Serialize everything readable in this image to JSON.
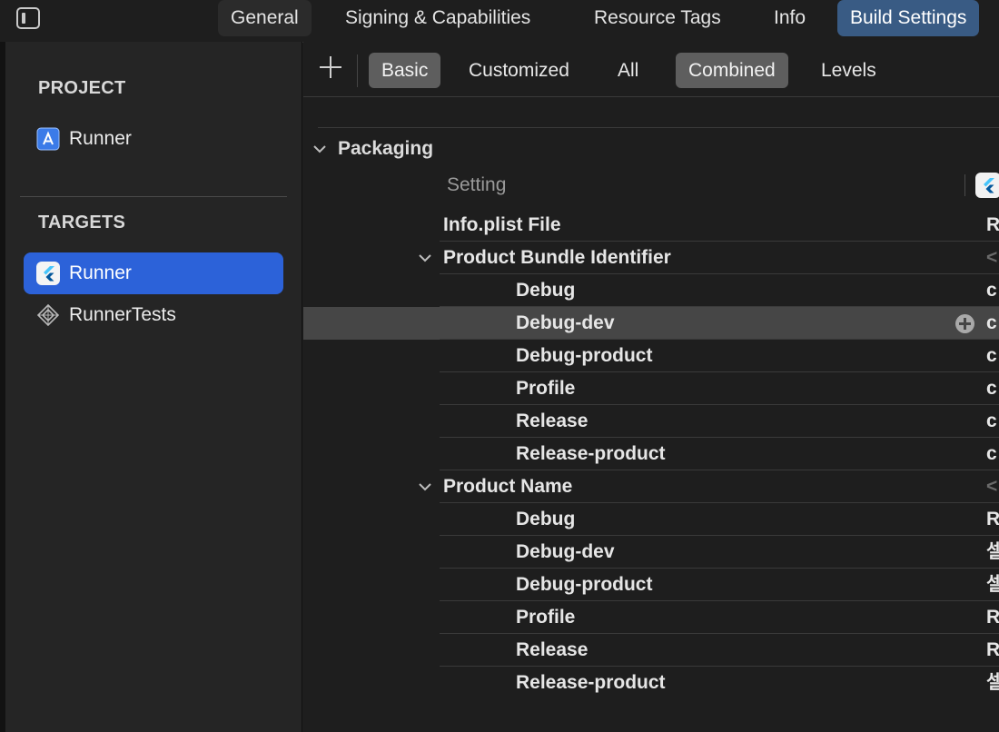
{
  "tabs": [
    {
      "label": "General",
      "active": false
    },
    {
      "label": "Signing & Capabilities",
      "active": false
    },
    {
      "label": "Resource Tags",
      "active": false
    },
    {
      "label": "Info",
      "active": false
    },
    {
      "label": "Build Settings",
      "active": true
    }
  ],
  "sidebar": {
    "project_heading": "PROJECT",
    "project_items": [
      {
        "label": "Runner",
        "icon": "xcode-project-icon"
      }
    ],
    "targets_heading": "TARGETS",
    "target_items": [
      {
        "label": "Runner",
        "icon": "flutter-app-icon",
        "selected": true
      },
      {
        "label": "RunnerTests",
        "icon": "test-bundle-icon",
        "selected": false
      }
    ]
  },
  "toolbar": {
    "add_icon": "plus-icon",
    "scope_filters": [
      {
        "label": "Basic",
        "selected": true
      },
      {
        "label": "Customized",
        "selected": false
      },
      {
        "label": "All",
        "selected": false
      }
    ],
    "view_modes": [
      {
        "label": "Combined",
        "selected": true
      },
      {
        "label": "Levels",
        "selected": false
      }
    ]
  },
  "section": {
    "title": "Packaging",
    "column_header": "Setting",
    "column_target_icon": "flutter-target-icon",
    "settings": [
      {
        "label": "Info.plist File",
        "value": "R"
      },
      {
        "label": "Product Bundle Identifier",
        "value": "<",
        "expanded": true,
        "configs": [
          {
            "label": "Debug",
            "value": "c"
          },
          {
            "label": "Debug-dev",
            "value": "c",
            "highlighted": true
          },
          {
            "label": "Debug-product",
            "value": "c"
          },
          {
            "label": "Profile",
            "value": "c"
          },
          {
            "label": "Release",
            "value": "c"
          },
          {
            "label": "Release-product",
            "value": "c"
          }
        ]
      },
      {
        "label": "Product Name",
        "value": "<",
        "expanded": true,
        "configs": [
          {
            "label": "Debug",
            "value": "R"
          },
          {
            "label": "Debug-dev",
            "value": "셀"
          },
          {
            "label": "Debug-product",
            "value": "셀"
          },
          {
            "label": "Profile",
            "value": "R"
          },
          {
            "label": "Release",
            "value": "R"
          },
          {
            "label": "Release-product",
            "value": "셀"
          }
        ]
      }
    ]
  },
  "colors": {
    "accent": "#2c62d9",
    "active_tab": "#395b84",
    "row_highlight": "#464646"
  }
}
